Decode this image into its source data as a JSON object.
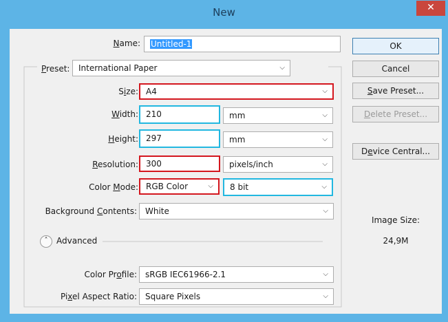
{
  "window": {
    "title": "New",
    "close_glyph": "✕"
  },
  "form": {
    "name": {
      "label_pre": "",
      "label_ul": "N",
      "label_post": "ame:",
      "value": "Untitled-1"
    },
    "preset": {
      "label_pre": "",
      "label_ul": "P",
      "label_post": "reset:",
      "value": "International Paper"
    },
    "size": {
      "label_pre": "S",
      "label_ul": "i",
      "label_post": "ze:",
      "value": "A4"
    },
    "width": {
      "label_pre": "",
      "label_ul": "W",
      "label_post": "idth:",
      "value": "210",
      "unit": "mm"
    },
    "height": {
      "label_pre": "",
      "label_ul": "H",
      "label_post": "eight:",
      "value": "297",
      "unit": "mm"
    },
    "resolution": {
      "label_pre": "",
      "label_ul": "R",
      "label_post": "esolution:",
      "value": "300",
      "unit": "pixels/inch"
    },
    "color_mode": {
      "label_pre": "Color ",
      "label_ul": "M",
      "label_post": "ode:",
      "value": "RGB Color",
      "depth": "8 bit"
    },
    "background": {
      "label_pre": "Background ",
      "label_ul": "C",
      "label_post": "ontents:",
      "value": "White"
    },
    "advanced": {
      "label": "Advanced",
      "icon": "chevron-up-circle-icon"
    },
    "color_profile": {
      "label_pre": "Color Pr",
      "label_ul": "o",
      "label_post": "file:",
      "value": "sRGB IEC61966-2.1"
    },
    "pixel_aspect": {
      "label_pre": "Pi",
      "label_ul": "x",
      "label_post": "el Aspect Ratio:",
      "value": "Square Pixels"
    }
  },
  "buttons": {
    "ok": "OK",
    "cancel": "Cancel",
    "save_preset": {
      "pre": "",
      "ul": "S",
      "post": "ave Preset..."
    },
    "delete_preset": {
      "pre": "",
      "ul": "D",
      "post": "elete Preset..."
    },
    "device_central": {
      "pre": "D",
      "ul": "e",
      "post": "vice Central..."
    }
  },
  "image_size": {
    "label": "Image Size:",
    "value": "24,9M"
  },
  "colors": {
    "highlight_red": "#d4161e",
    "highlight_blue": "#21b7e0",
    "titlebar": "#5db4e6",
    "close": "#c9463d"
  }
}
